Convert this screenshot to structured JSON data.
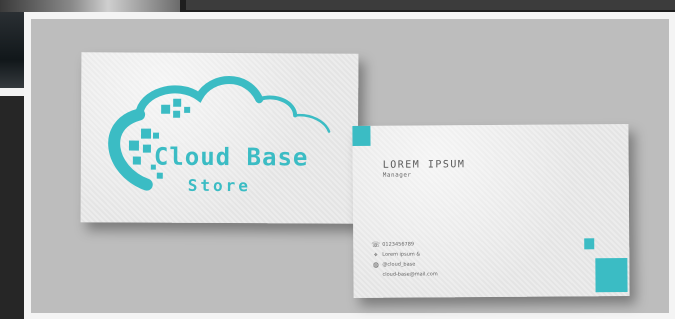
{
  "colors": {
    "accent": "#3bbcc4",
    "panel_bg": "#bdbdbd",
    "frame": "#f4f4f4",
    "card": "#e8e8e8"
  },
  "front_card": {
    "brand_name": "Cloud Base",
    "brand_sub": "Store",
    "logo_icon": "cloud-pixel-icon"
  },
  "back_card": {
    "name": "LOREM IPSUM",
    "title": "Manager",
    "contacts": [
      {
        "icon": "phone-icon",
        "text": "0123456789"
      },
      {
        "icon": "location-icon",
        "text": "Lorem ipsum &"
      },
      {
        "icon": "globe-icon",
        "text": "@cloud_base"
      },
      {
        "icon": "",
        "text": "cloud-base@mail.com"
      }
    ]
  }
}
